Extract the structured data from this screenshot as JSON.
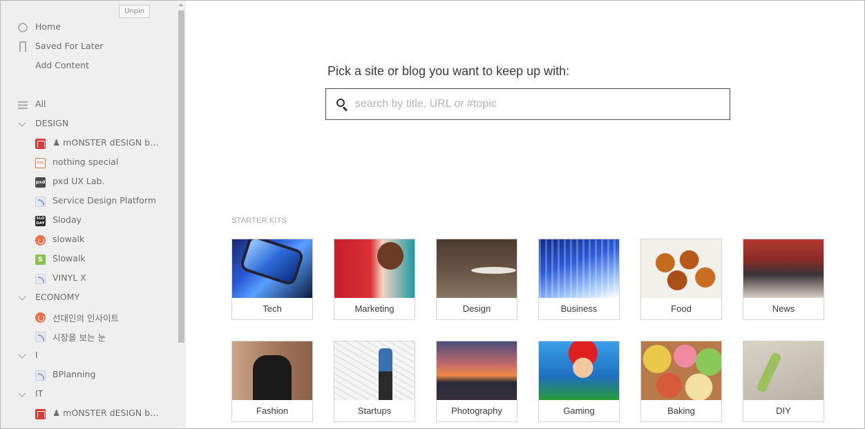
{
  "sidebar": {
    "unpin_label": "Unpin",
    "top_items": [
      {
        "label": "Home",
        "icon": "home-icon"
      },
      {
        "label": "Saved For Later",
        "icon": "bookmark-icon"
      },
      {
        "label": "Add Content",
        "icon": ""
      }
    ],
    "all_label": "All",
    "categories": [
      {
        "label": "DESIGN",
        "feeds": [
          {
            "label": "♟ mONSTER dESIGN b…",
            "icon": "monster-design-favicon",
            "fav_text": ""
          },
          {
            "label": "nothing special",
            "icon": "percent-favicon",
            "fav_text": "0%"
          },
          {
            "label": "pxd UX Lab.",
            "icon": "pxd-favicon",
            "fav_text": "pxd"
          },
          {
            "label": "Service Design Platform",
            "icon": "rss-icon",
            "fav_text": ""
          },
          {
            "label": "Sloday",
            "icon": "sloday-favicon",
            "fav_text": "SLO DAY"
          },
          {
            "label": "slowalk",
            "icon": "slowalk-favicon",
            "fav_text": ""
          },
          {
            "label": "Slowalk",
            "icon": "s-favicon",
            "fav_text": "S"
          },
          {
            "label": "VINYL X",
            "icon": "rss-icon",
            "fav_text": ""
          }
        ]
      },
      {
        "label": "ECONOMY",
        "feeds": [
          {
            "label": "선대인의 인사이트",
            "icon": "slowalk-favicon",
            "fav_text": ""
          },
          {
            "label": "시장을 보는 눈",
            "icon": "rss-icon",
            "fav_text": ""
          }
        ]
      },
      {
        "label": "I",
        "feeds": [
          {
            "label": "BPlanning",
            "icon": "rss-icon",
            "fav_text": ""
          }
        ]
      },
      {
        "label": "IT",
        "feeds": [
          {
            "label": "♟ mONSTER dESIGN b…",
            "icon": "monster-design-favicon",
            "fav_text": ""
          }
        ]
      }
    ]
  },
  "main": {
    "prompt": "Pick a site or blog you want to keep up with:",
    "search_placeholder": "search by title, URL or #topic",
    "search_value": "",
    "starter_kits_label": "STARTER KITS",
    "kits": [
      {
        "label": "Tech",
        "thumb": "tech"
      },
      {
        "label": "Marketing",
        "thumb": "mkt"
      },
      {
        "label": "Design",
        "thumb": "design"
      },
      {
        "label": "Business",
        "thumb": "biz"
      },
      {
        "label": "Food",
        "thumb": "food"
      },
      {
        "label": "News",
        "thumb": "news"
      },
      {
        "label": "Fashion",
        "thumb": "fashion"
      },
      {
        "label": "Startups",
        "thumb": "startups"
      },
      {
        "label": "Photography",
        "thumb": "photo"
      },
      {
        "label": "Gaming",
        "thumb": "gaming"
      },
      {
        "label": "Baking",
        "thumb": "baking"
      },
      {
        "label": "DIY",
        "thumb": "diy"
      }
    ]
  }
}
